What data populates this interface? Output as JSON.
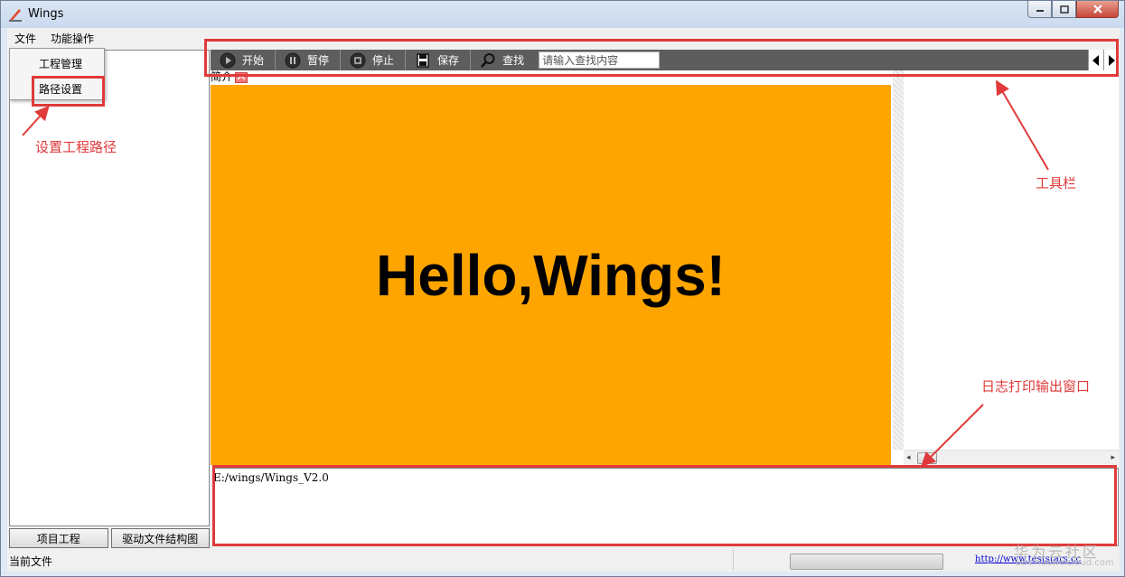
{
  "window": {
    "title": "Wings"
  },
  "menu": {
    "items": [
      "文件",
      "功能操作"
    ]
  },
  "dropdown": {
    "items": [
      "工程管理",
      "路径设置"
    ]
  },
  "toolbar": {
    "buttons": [
      {
        "label": "开始",
        "icon": "play-icon"
      },
      {
        "label": "暂停",
        "icon": "pause-icon"
      },
      {
        "label": "停止",
        "icon": "stop-icon"
      },
      {
        "label": "保存",
        "icon": "save-icon"
      },
      {
        "label": "查找",
        "icon": "search-icon"
      }
    ],
    "search_placeholder": "请输入查找内容"
  },
  "content": {
    "intro_label": "简介",
    "hello_text": "Hello,Wings!",
    "hello_bg": "#ffa500"
  },
  "log": {
    "text": "E:/wings/Wings_V2.0"
  },
  "left_tabs": [
    "项目工程",
    "驱动文件结构图"
  ],
  "status": {
    "label": "当前文件",
    "link": "http://www.teststars.cc"
  },
  "annotations": {
    "path_setting": "设置工程路径",
    "toolbar": "工具栏",
    "log_window": "日志打印输出窗口",
    "color": "#e03a3a"
  },
  "watermark": {
    "main": "华为云社区",
    "sub": "bbs.huaweicloud.com"
  }
}
